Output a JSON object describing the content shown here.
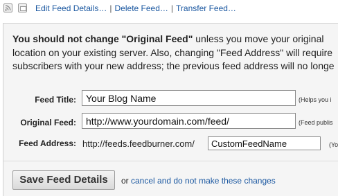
{
  "toolbar": {
    "icons": [
      "feed-icon",
      "window-icon"
    ],
    "links": [
      {
        "label": "Edit Feed Details…"
      },
      {
        "label": "Delete Feed…"
      },
      {
        "label": "Transfer Feed…"
      }
    ],
    "separator": "|"
  },
  "warning": {
    "bold_part": "You should not change \"Original Feed\"",
    "line1_rest": " unless you move your original",
    "line2": "location on your existing server. Also, changing \"Feed Address\" will require",
    "line3": "subscribers with your new address; the previous feed address will no longe"
  },
  "form": {
    "feed_title": {
      "label": "Feed Title:",
      "value": "Your Blog Name",
      "help": "(Helps you i"
    },
    "original_feed": {
      "label": "Original Feed:",
      "value": "http://www.yourdomain.com/feed/",
      "help": "(Feed publis"
    },
    "feed_address": {
      "label": "Feed Address:",
      "prefix": "http://feeds.feedburner.com/",
      "value": "CustomFeedName",
      "help": "(Your"
    }
  },
  "actions": {
    "save_label": "Save Feed Details",
    "or_text": "or",
    "cancel_label": "cancel and do not make these changes"
  },
  "colors": {
    "link": "#1a57a0",
    "panel_bg": "#f5f5f5"
  }
}
